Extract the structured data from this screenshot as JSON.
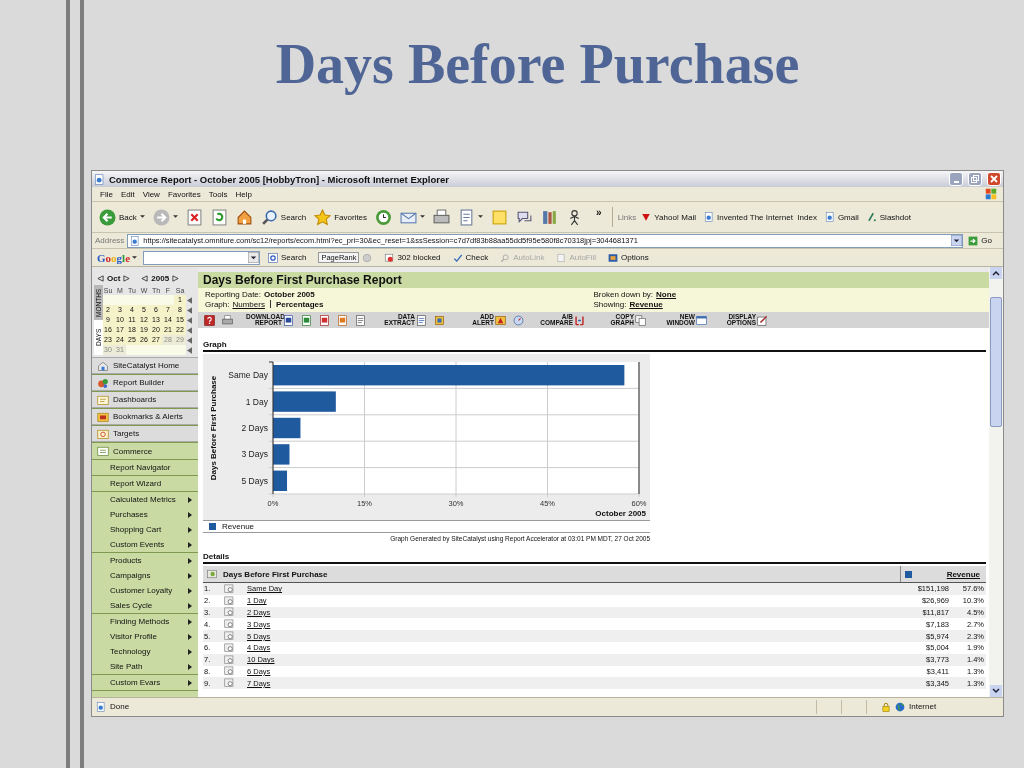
{
  "slide": {
    "title": "Days Before Purchase"
  },
  "window": {
    "title": "Commerce Report - October 2005 [HobbyTron] - Microsoft Internet Explorer"
  },
  "menu": [
    "File",
    "Edit",
    "View",
    "Favorites",
    "Tools",
    "Help"
  ],
  "toolbar": [
    {
      "kind": "back",
      "label": "Back",
      "dropdown": true
    },
    {
      "kind": "forward",
      "dropdown": true
    },
    {
      "kind": "stop",
      "dropdown": false
    },
    {
      "kind": "refresh",
      "dropdown": false
    },
    {
      "kind": "home",
      "dropdown": false
    },
    {
      "kind": "search",
      "label": "Search",
      "dropdown": false
    },
    {
      "kind": "favorites",
      "label": "Favorites",
      "dropdown": false
    },
    {
      "kind": "history",
      "dropdown": false
    },
    {
      "kind": "mail",
      "dropdown": true
    },
    {
      "kind": "print",
      "dropdown": false
    },
    {
      "kind": "edit",
      "dropdown": true
    },
    {
      "kind": "note",
      "dropdown": false
    },
    {
      "kind": "discuss",
      "dropdown": false
    },
    {
      "kind": "research",
      "dropdown": false
    },
    {
      "kind": "messenger",
      "dropdown": false
    }
  ],
  "toolbar_more": "»",
  "links": {
    "label": "Links",
    "items": [
      {
        "kind": "red",
        "label": "Yahoo! Mail"
      },
      {
        "kind": "page",
        "label": "Invented The Internet  Index"
      },
      {
        "kind": "page",
        "label": "Gmail"
      },
      {
        "kind": "slash",
        "label": "Slashdot"
      }
    ]
  },
  "address": {
    "label": "Address",
    "url": "https://sitecatalyst.omniture.com/sc12/reports/ecom.html?ec_pri=30&ec_reset=1&ssSession=c7d7df83b88aa55dd5f95e580f8c70318jpj=3044681371",
    "go": "Go"
  },
  "google_bar": {
    "logo": "Google",
    "items": [
      {
        "kind": "search",
        "label": "Search",
        "disabled": false
      },
      {
        "kind": "pagerank",
        "label": "PageRank",
        "disabled": false
      },
      {
        "kind": "blocked",
        "label": "302 blocked",
        "disabled": false
      },
      {
        "kind": "check",
        "label": "Check",
        "disabled": false
      },
      {
        "kind": "autolink",
        "label": "AutoLink",
        "disabled": true
      },
      {
        "kind": "autofill",
        "label": "AutoFill",
        "disabled": true
      },
      {
        "kind": "options",
        "label": "Options",
        "disabled": false
      }
    ]
  },
  "calendar": {
    "month": "Oct",
    "year": "2005",
    "tabs": [
      {
        "label": "MONTHS",
        "selected": false
      },
      {
        "label": "DAYS",
        "selected": true
      }
    ],
    "weekdays": [
      "Su",
      "M",
      "Tu",
      "W",
      "Th",
      "F",
      "Sa"
    ],
    "weeks": [
      [
        {
          "label": "1",
          "disabled": false
        }
      ],
      [
        {
          "label": "2",
          "disabled": false
        },
        {
          "label": "3",
          "disabled": false
        },
        {
          "label": "4",
          "disabled": false
        },
        {
          "label": "5",
          "disabled": false
        },
        {
          "label": "6",
          "disabled": false
        },
        {
          "label": "7",
          "disabled": false
        },
        {
          "label": "8",
          "disabled": false
        }
      ],
      [
        {
          "label": "9",
          "disabled": false
        },
        {
          "label": "10",
          "disabled": false
        },
        {
          "label": "11",
          "disabled": false
        },
        {
          "label": "12",
          "disabled": false
        },
        {
          "label": "13",
          "disabled": false
        },
        {
          "label": "14",
          "disabled": false
        },
        {
          "label": "15",
          "disabled": false
        }
      ],
      [
        {
          "label": "16",
          "disabled": false
        },
        {
          "label": "17",
          "disabled": false
        },
        {
          "label": "18",
          "disabled": false
        },
        {
          "label": "19",
          "disabled": false
        },
        {
          "label": "20",
          "disabled": false
        },
        {
          "label": "21",
          "disabled": false
        },
        {
          "label": "22",
          "disabled": false
        }
      ],
      [
        {
          "label": "23",
          "disabled": false
        },
        {
          "label": "24",
          "disabled": false
        },
        {
          "label": "25",
          "disabled": false
        },
        {
          "label": "26",
          "disabled": false
        },
        {
          "label": "27",
          "disabled": false
        },
        {
          "label": "28",
          "disabled": true
        },
        {
          "label": "29",
          "disabled": true
        }
      ],
      [
        {
          "label": "30",
          "disabled": true
        },
        {
          "label": "31",
          "disabled": true
        }
      ]
    ]
  },
  "nav": [
    {
      "items": [
        {
          "label": "SiteCatalyst Home",
          "kind": "top",
          "selected": false,
          "submenu": false
        }
      ]
    },
    {
      "items": [
        {
          "label": "Report Builder",
          "kind": "top",
          "selected": false,
          "submenu": false
        }
      ]
    },
    {
      "items": [
        {
          "label": "Dashboards",
          "kind": "top",
          "selected": false,
          "submenu": false
        }
      ]
    },
    {
      "items": [
        {
          "label": "Bookmarks & Alerts",
          "kind": "top",
          "selected": false,
          "submenu": false
        }
      ]
    },
    {
      "items": [
        {
          "label": "Targets",
          "kind": "top",
          "selected": false,
          "submenu": false
        }
      ]
    },
    {
      "items": [
        {
          "label": "Commerce",
          "kind": "top",
          "selected": true,
          "submenu": false
        }
      ]
    },
    {
      "items": [
        {
          "label": "Report Navigator",
          "kind": "sub",
          "selected": false,
          "submenu": false
        }
      ]
    },
    {
      "items": [
        {
          "label": "Report Wizard",
          "kind": "sub",
          "selected": false,
          "submenu": false
        }
      ]
    },
    {
      "items": [
        {
          "label": "Calculated Metrics",
          "kind": "sub",
          "selected": false,
          "submenu": true
        },
        {
          "label": "Purchases",
          "kind": "sub",
          "selected": false,
          "submenu": true
        },
        {
          "label": "Shopping Cart",
          "kind": "sub",
          "selected": false,
          "submenu": true
        },
        {
          "label": "Custom Events",
          "kind": "sub",
          "selected": false,
          "submenu": true
        }
      ]
    },
    {
      "items": [
        {
          "label": "Products",
          "kind": "sub",
          "selected": false,
          "submenu": true
        },
        {
          "label": "Campaigns",
          "kind": "sub",
          "selected": false,
          "submenu": true
        },
        {
          "label": "Customer Loyalty",
          "kind": "sub",
          "selected": false,
          "submenu": true
        },
        {
          "label": "Sales Cycle",
          "kind": "sub",
          "selected": false,
          "submenu": true
        }
      ]
    },
    {
      "items": [
        {
          "label": "Finding Methods",
          "kind": "sub",
          "selected": false,
          "submenu": true
        },
        {
          "label": "Visitor Profile",
          "kind": "sub",
          "selected": false,
          "submenu": true
        },
        {
          "label": "Technology",
          "kind": "sub",
          "selected": false,
          "submenu": true
        },
        {
          "label": "Site Path",
          "kind": "sub",
          "selected": false,
          "submenu": true
        }
      ]
    },
    {
      "items": [
        {
          "label": "Custom Evars",
          "kind": "sub",
          "selected": false,
          "submenu": true
        }
      ]
    }
  ],
  "report": {
    "title": "Days Before First Purchase Report",
    "reporting_date": {
      "label": "Reporting Date:",
      "value": "October 2005"
    },
    "graph_mode": {
      "label": "Graph:",
      "options": [
        {
          "label": "Numbers",
          "selected": false
        },
        {
          "label": "Percentages",
          "selected": true
        }
      ]
    },
    "broken_down_by": {
      "label": "Broken down by:",
      "value": "None"
    },
    "showing": {
      "label": "Showing:",
      "value": "Revenue"
    },
    "tools": [
      {
        "kind": "help"
      },
      {
        "kind": "print"
      },
      {
        "kind": "word",
        "label": "DOWNLOAD REPORT"
      },
      {
        "kind": "excel"
      },
      {
        "kind": "pdf"
      },
      {
        "kind": "html"
      },
      {
        "kind": "text"
      },
      {
        "kind": "extract",
        "label": "DATA EXTRACT"
      },
      {
        "kind": "bookmark"
      },
      {
        "kind": "alert",
        "label": "ADD ALERT"
      },
      {
        "kind": "dashboard"
      },
      {
        "kind": "compare",
        "label": "A/B COMPARE"
      },
      {
        "kind": "copy",
        "label": "COPY GRAPH"
      },
      {
        "kind": "window",
        "label": "NEW WINDOW"
      },
      {
        "kind": "options",
        "label": "DISPLAY OPTIONS"
      }
    ],
    "graph": {
      "heading": "Graph",
      "footer": "Graph Generated by SiteCatalyst using Report Accelerator at 03:01 PM MDT, 27 Oct 2005",
      "chart_data": {
        "type": "bar",
        "orientation": "horizontal",
        "ylabel": "Days Before First Purchase",
        "xlabel": "October 2005",
        "grid": true,
        "categories": [
          "Same Day",
          "1 Day",
          "2 Days",
          "3 Days",
          "5 Days"
        ],
        "series": [
          {
            "name": "Revenue",
            "color": "#1f5a9e",
            "values": [
              57.6,
              10.3,
              4.5,
              2.7,
              2.3
            ]
          }
        ],
        "xlim": [
          0,
          60
        ],
        "xticks": [
          {
            "value": 0,
            "label": "0%"
          },
          {
            "value": 15,
            "label": "15%"
          },
          {
            "value": 30,
            "label": "30%"
          },
          {
            "value": 45,
            "label": "45%"
          },
          {
            "value": 60,
            "label": "60%"
          }
        ]
      }
    },
    "details": {
      "heading": "Details",
      "columns": [
        "Days Before First Purchase",
        "Revenue"
      ],
      "rows": [
        {
          "rank": "1.",
          "name": "Same Day",
          "revenue": "$151,198",
          "share": "57.6%"
        },
        {
          "rank": "2.",
          "name": "1 Day",
          "revenue": "$26,969",
          "share": "10.3%"
        },
        {
          "rank": "3.",
          "name": "2 Days",
          "revenue": "$11,817",
          "share": "4.5%"
        },
        {
          "rank": "4.",
          "name": "3 Days",
          "revenue": "$7,183",
          "share": "2.7%"
        },
        {
          "rank": "5.",
          "name": "5 Days",
          "revenue": "$5,974",
          "share": "2.3%"
        },
        {
          "rank": "6.",
          "name": "4 Days",
          "revenue": "$5,004",
          "share": "1.9%"
        },
        {
          "rank": "7.",
          "name": "10 Days",
          "revenue": "$3,773",
          "share": "1.4%"
        },
        {
          "rank": "8.",
          "name": "6 Days",
          "revenue": "$3,411",
          "share": "1.3%"
        },
        {
          "rank": "9.",
          "name": "7 Days",
          "revenue": "$3,345",
          "share": "1.3%"
        }
      ]
    }
  },
  "status_bar": {
    "text": "Done",
    "zone": "Internet"
  }
}
